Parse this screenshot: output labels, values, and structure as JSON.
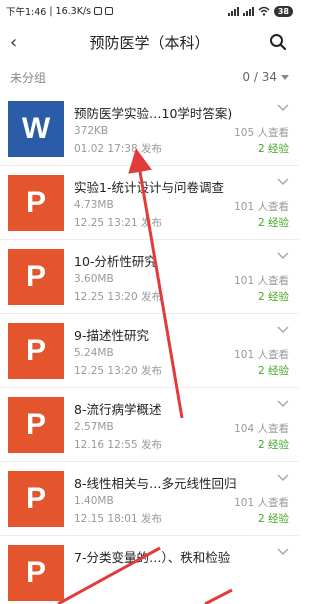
{
  "status": {
    "time": "下午1:46",
    "speed": "16.3K/s",
    "battery": "38"
  },
  "header": {
    "back_icon": "‹",
    "title": "预防医学（本科）"
  },
  "group": {
    "name": "未分组",
    "count": "0 / 34"
  },
  "items": [
    {
      "type": "W",
      "name": "预防医学实验…10学时答案)",
      "size": "372KB",
      "date": "01.02 17:38 发布",
      "views": "105 人查看",
      "exp": "2 经验"
    },
    {
      "type": "P",
      "name": "实验1-统计设计与问卷调查",
      "size": "4.73MB",
      "date": "12.25 13:21 发布",
      "views": "101 人查看",
      "exp": "2 经验"
    },
    {
      "type": "P",
      "name": "10-分析性研究",
      "size": "3.60MB",
      "date": "12.25 13:20 发布",
      "views": "101 人查看",
      "exp": "2 经验"
    },
    {
      "type": "P",
      "name": "9-描述性研究",
      "size": "5.24MB",
      "date": "12.25 13:20 发布",
      "views": "101 人查看",
      "exp": "2 经验"
    },
    {
      "type": "P",
      "name": "8-流行病学概述",
      "size": "2.57MB",
      "date": "12.16 12:55 发布",
      "views": "104 人查看",
      "exp": "2 经验"
    },
    {
      "type": "P",
      "name": "8-线性相关与…多元线性回归",
      "size": "1.40MB",
      "date": "12.15 18:01 发布",
      "views": "101 人查看",
      "exp": "2 经验"
    },
    {
      "type": "P",
      "name": "7-分类变量的…）、秩和检验",
      "size": "",
      "date": "",
      "views": "",
      "exp": ""
    }
  ],
  "colors": {
    "word": "#2b5ca8",
    "ppt": "#e4552d",
    "experience": "#45a524",
    "annotation_arrow": "#e23b3b"
  }
}
